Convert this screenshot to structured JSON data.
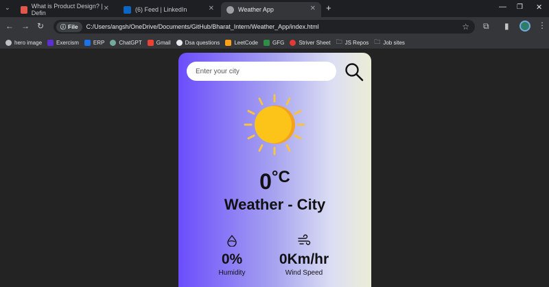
{
  "browser": {
    "tabs": [
      {
        "title": "What is Product Design? | Defin",
        "color": "#e2574c"
      },
      {
        "title": "(6) Feed | LinkedIn",
        "color": "#0a66c2"
      },
      {
        "title": "Weather App",
        "color": "#9aa0a6"
      }
    ],
    "address_chip": "File",
    "address": "C:/Users/angsh/OneDrive/Documents/GitHub/Bharat_Intern/Weather_App/index.html",
    "bookmarks": [
      {
        "label": "hero image",
        "color": "#bdc1c6"
      },
      {
        "label": "Exercism",
        "color": "#5c2fd6"
      },
      {
        "label": "ERP",
        "color": "#1a73e8"
      },
      {
        "label": "ChatGPT",
        "color": "#74aa9c"
      },
      {
        "label": "Gmail",
        "color": "#ea4335"
      },
      {
        "label": "Dsa questions",
        "color": "#e8eaed"
      },
      {
        "label": "LeetCode",
        "color": "#ffa116"
      },
      {
        "label": "GFG",
        "color": "#2f8d46"
      },
      {
        "label": "Striver Sheet",
        "color": "#e53935"
      },
      {
        "label": "JS Repos",
        "color": "#9aa0a6"
      },
      {
        "label": "Job sites",
        "color": "#9aa0a6"
      }
    ]
  },
  "app": {
    "search_placeholder": "Enter your city",
    "temperature": "0",
    "temp_unit": "°C",
    "city": "Weather - City",
    "humidity_value": "0%",
    "humidity_label": "Humidity",
    "wind_value": "0Km/hr",
    "wind_label": "Wind Speed",
    "weather_icon": "sun-icon"
  }
}
